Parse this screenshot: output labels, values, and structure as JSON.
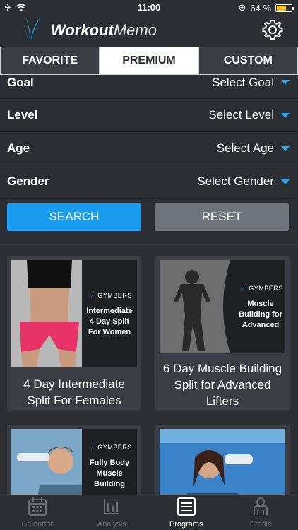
{
  "status": {
    "time": "11:00",
    "battery": "64 %",
    "battery_level": 0.64
  },
  "app": {
    "logo_bold": "Workout",
    "logo_light": "Memo"
  },
  "tabs": [
    {
      "label": "FAVORITE",
      "active": false
    },
    {
      "label": "PREMIUM",
      "active": true
    },
    {
      "label": "CUSTOM",
      "active": false
    }
  ],
  "filters": [
    {
      "label": "Goal",
      "value": "Select Goal"
    },
    {
      "label": "Level",
      "value": "Select Level"
    },
    {
      "label": "Age",
      "value": "Select Age"
    },
    {
      "label": "Gender",
      "value": "Select Gender"
    }
  ],
  "actions": {
    "search": "SEARCH",
    "reset": "RESET"
  },
  "programs": [
    {
      "title": "4 Day Intermediate Split For Females",
      "brand": "GYMBERS",
      "image_text": "Intermediate 4 Day Split For Women"
    },
    {
      "title": "6 Day Muscle Building Split for Advanced Lifters",
      "brand": "GYMBERS",
      "image_text": "Muscle Building for Advanced"
    },
    {
      "title": "",
      "brand": "GYMBERS",
      "image_text": "Fully Body Muscle Building"
    },
    {
      "title": "",
      "brand": "",
      "image_text": ""
    }
  ],
  "bottom_nav": [
    {
      "label": "Calendar",
      "icon": "calendar-icon",
      "active": false
    },
    {
      "label": "Analysis",
      "icon": "bar-chart-icon",
      "active": false
    },
    {
      "label": "Programs",
      "icon": "list-icon",
      "active": true
    },
    {
      "label": "Profile",
      "icon": "profile-icon",
      "active": false
    }
  ],
  "colors": {
    "accent": "#1a9df0",
    "background": "#2b2e33",
    "card": "#3a3e44",
    "reset": "#6f747c"
  }
}
